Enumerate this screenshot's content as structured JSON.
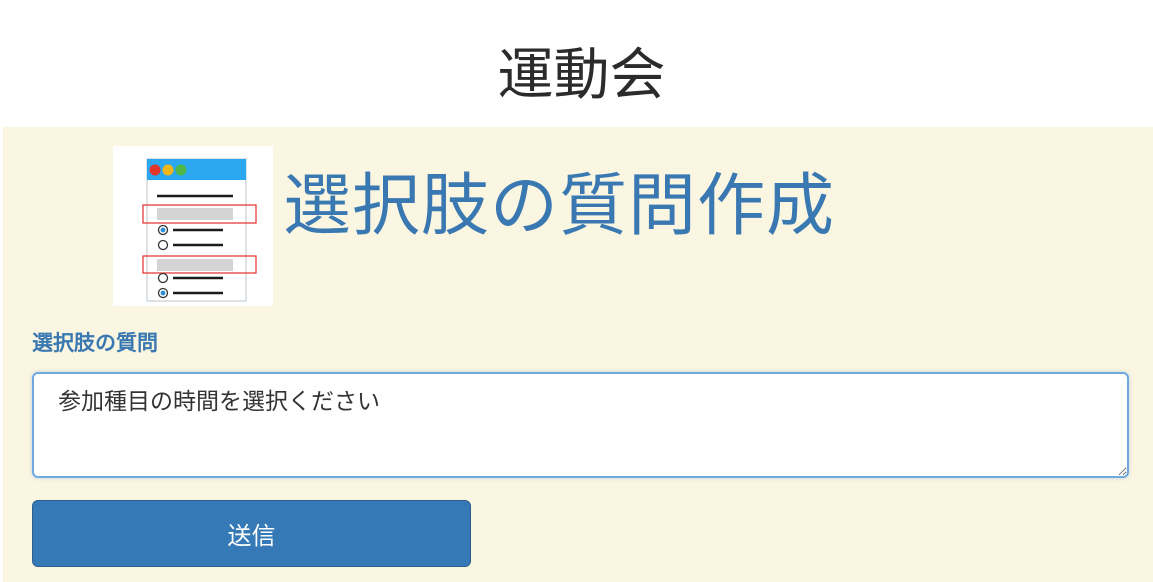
{
  "app": {
    "title": "運動会"
  },
  "form": {
    "heading": "選択肢の質問作成",
    "illustration_icon": "multiple-choice-form-illustration",
    "question_label": "選択肢の質問",
    "question_value": "参加種目の時間を選択ください",
    "submit_label": "送信"
  },
  "colors": {
    "panel_background": "#fbf6e1",
    "accent_blue": "#3a78b2",
    "button_blue": "#357ab7",
    "input_focus_border": "#6ea9e0"
  }
}
